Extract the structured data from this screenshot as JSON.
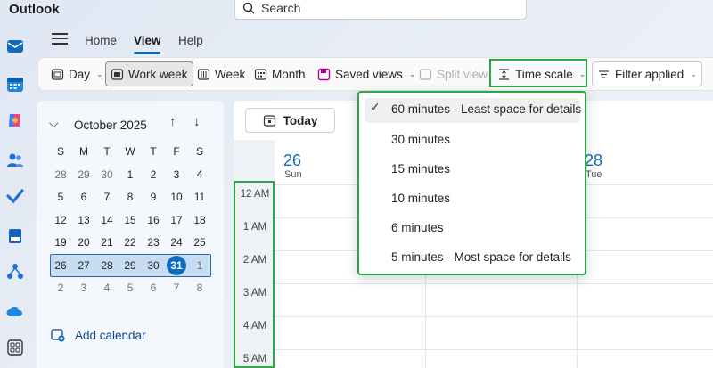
{
  "app": {
    "title": "Outlook"
  },
  "search": {
    "placeholder": "Search"
  },
  "menu": {
    "tabs": [
      "Home",
      "View",
      "Help"
    ],
    "active": "View"
  },
  "ribbon": {
    "day": "Day",
    "work_week": "Work week",
    "week": "Week",
    "month": "Month",
    "saved_views": "Saved views",
    "split_view": "Split view",
    "time_scale": "Time scale",
    "filter": "Filter applied"
  },
  "mini_calendar": {
    "month_label": "October 2025",
    "weekdays": [
      "S",
      "M",
      "T",
      "W",
      "T",
      "F",
      "S"
    ],
    "weeks": [
      [
        "28",
        "29",
        "30",
        "1",
        "2",
        "3",
        "4"
      ],
      [
        "5",
        "6",
        "7",
        "8",
        "9",
        "10",
        "11"
      ],
      [
        "12",
        "13",
        "14",
        "15",
        "16",
        "17",
        "18"
      ],
      [
        "19",
        "20",
        "21",
        "22",
        "23",
        "24",
        "25"
      ],
      [
        "26",
        "27",
        "28",
        "29",
        "30",
        "31",
        "1"
      ],
      [
        "2",
        "3",
        "4",
        "5",
        "6",
        "7",
        "8"
      ]
    ],
    "today": "31",
    "add_calendar": "Add calendar"
  },
  "main": {
    "today_button": "Today",
    "day_columns": [
      {
        "date": "26",
        "weekday": "Sun"
      },
      {
        "date": "28",
        "weekday": "Tue"
      }
    ],
    "hours": [
      "12 AM",
      "1 AM",
      "2 AM",
      "3 AM",
      "4 AM",
      "5 AM"
    ]
  },
  "time_scale_menu": {
    "selected_index": 0,
    "items": [
      "60 minutes - Least space for details",
      "30 minutes",
      "15 minutes",
      "10 minutes",
      "6 minutes",
      "5 minutes - Most space for details"
    ]
  },
  "colors": {
    "accent": "#0f6cbd",
    "highlight": "#2ea843"
  }
}
